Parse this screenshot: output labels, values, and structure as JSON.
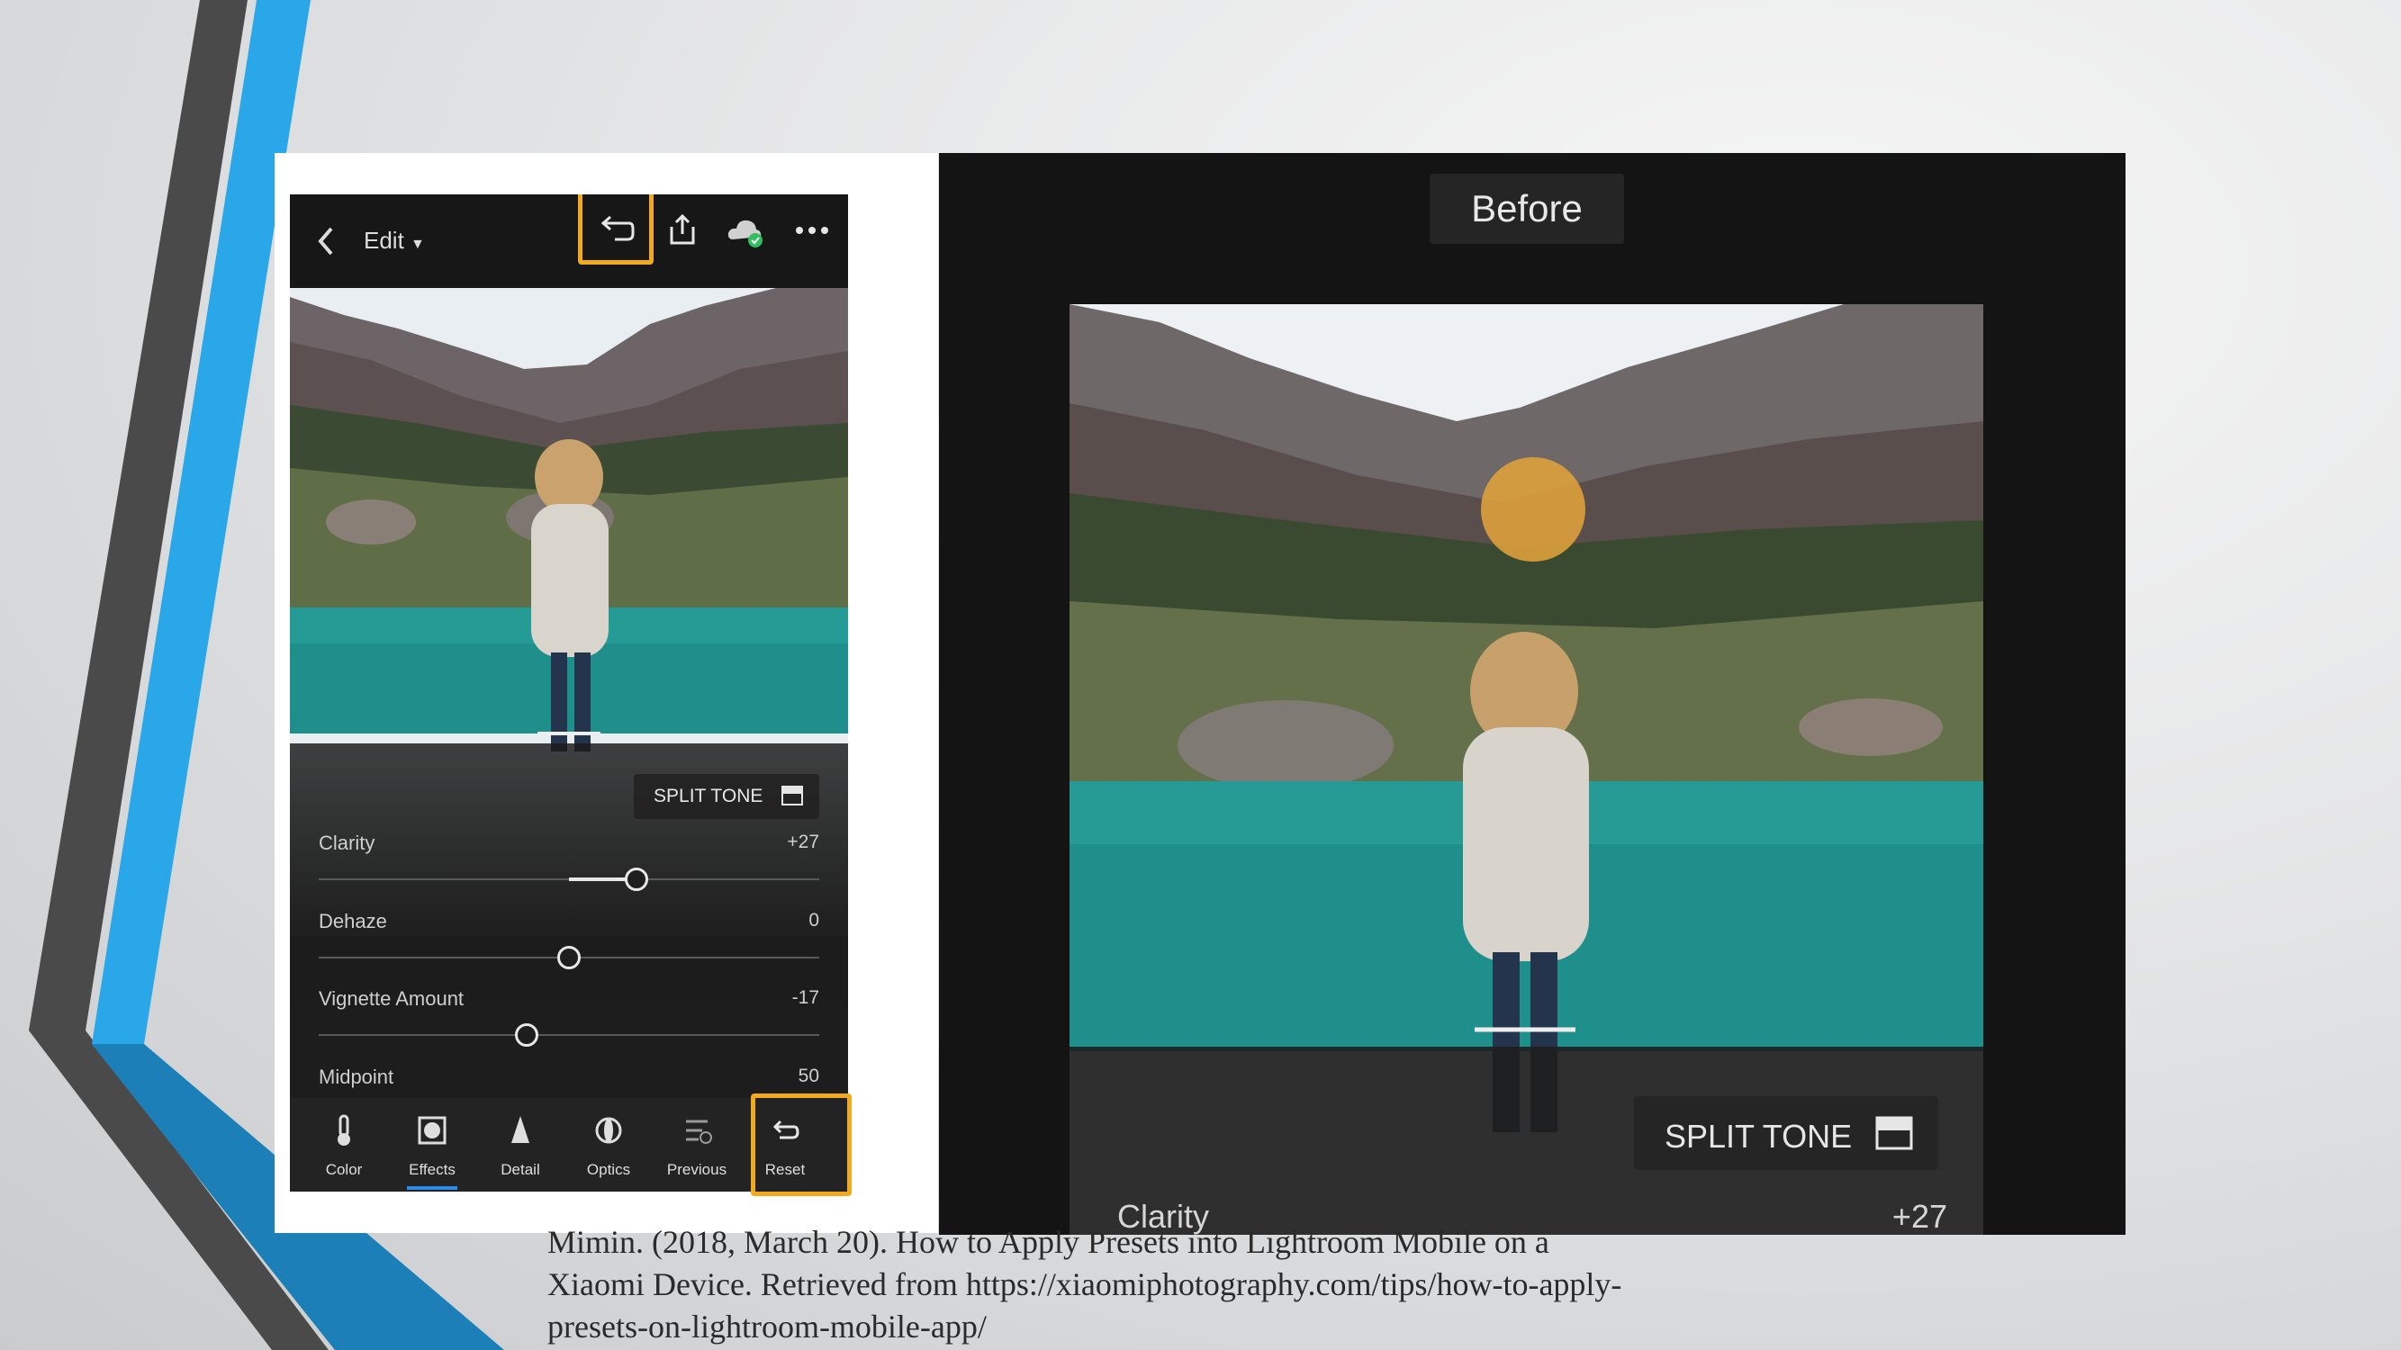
{
  "phone": {
    "topbar": {
      "back_icon": "chevron-left-icon",
      "edit_label": "Edit",
      "undo_icon": "undo-icon",
      "share_icon": "share-icon",
      "cloud_icon": "cloud-synced-icon",
      "more_icon": "more-icon"
    },
    "split_tone_label": "SPLIT TONE",
    "sliders": [
      {
        "label": "Clarity",
        "value": "+27",
        "level": 27
      },
      {
        "label": "Dehaze",
        "value": "0",
        "level": 0
      },
      {
        "label": "Vignette Amount",
        "value": "-17",
        "level": -17
      },
      {
        "label": "Midpoint",
        "value": "50",
        "level": 50
      }
    ],
    "tools": [
      {
        "label": "Color",
        "icon": "thermometer-icon"
      },
      {
        "label": "Effects",
        "icon": "effects-icon"
      },
      {
        "label": "Detail",
        "icon": "detail-icon"
      },
      {
        "label": "Optics",
        "icon": "optics-icon"
      },
      {
        "label": "Previous",
        "icon": "previous-icon"
      },
      {
        "label": "Reset",
        "icon": "reset-icon"
      }
    ]
  },
  "preview": {
    "before_label": "Before",
    "split_tone_label": "SPLIT TONE",
    "clarity_label": "Clarity",
    "clarity_value": "+27"
  },
  "citation": {
    "line1": "Mimin. (2018, March 20). How to Apply Presets into Lightroom Mobile on a",
    "line2": "Xiaomi Device. Retrieved from https://xiaomiphotography.com/tips/how-to-apply-",
    "line3": "presets-on-lightroom-mobile-app/"
  },
  "colors": {
    "highlight": "#f2a91c",
    "accent_blue": "#2aa7e8",
    "dark_stripe": "#4a4a4a",
    "lake": "#1f8f8c"
  }
}
